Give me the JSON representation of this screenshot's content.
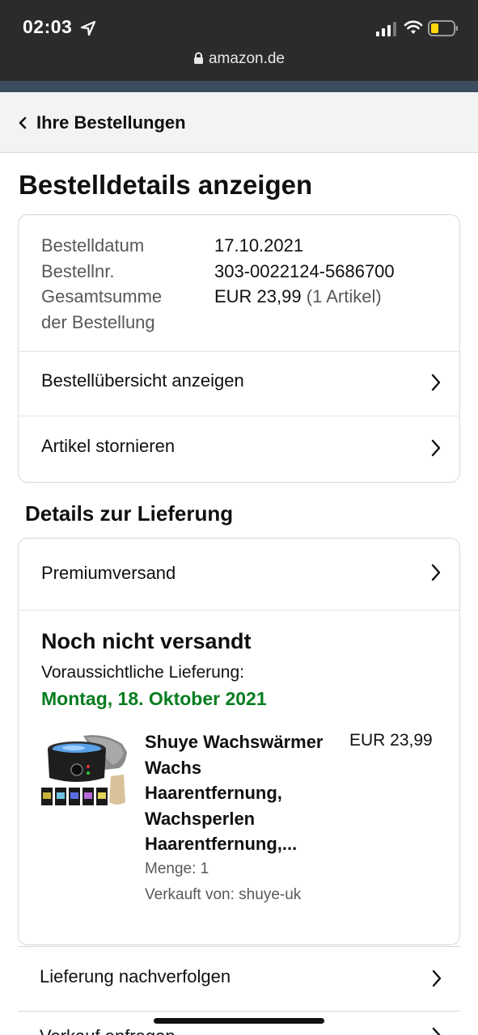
{
  "status_bar": {
    "time": "02:03",
    "url": "amazon.de"
  },
  "nav": {
    "back_label": "Ihre Bestellungen"
  },
  "page": {
    "title": "Bestelldetails anzeigen"
  },
  "order_summary": {
    "date_label": "Bestelldatum",
    "date_value": "17.10.2021",
    "number_label": "Bestellnr.",
    "number_value": "303-0022124-5686700",
    "total_label_line1": "Gesamtsumme",
    "total_label_line2": "der Bestellung",
    "total_value": "EUR 23,99",
    "total_items": "(1 Artikel)",
    "overview_link": "Bestellübersicht anzeigen",
    "cancel_link": "Artikel stornieren"
  },
  "delivery": {
    "section_title": "Details zur Lieferung",
    "shipping_method": "Premiumversand",
    "status": "Noch nicht versandt",
    "eta_label": "Voraussichtliche Lieferung:",
    "eta_date": "Montag, 18. Oktober 2021",
    "product": {
      "name": "Shuye Wachswärmer Wachs Haarentfernung, Wachsperlen Haarentfernung,...",
      "price": "EUR 23,99",
      "quantity": "Menge: 1",
      "seller": "Verkauft von: shuye-uk"
    },
    "track_link": "Lieferung nachverfolgen",
    "next_link": "Verkauf anfragen"
  },
  "colors": {
    "topbar": "#2b2b2b",
    "strip": "#3b4c5e",
    "eta_green": "#067d20",
    "text": "#0f1111",
    "muted": "#565959"
  }
}
